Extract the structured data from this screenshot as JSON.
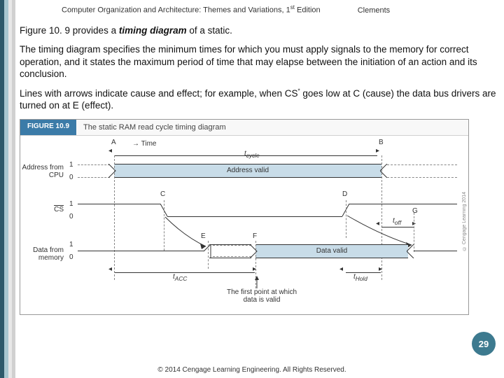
{
  "header": {
    "title_pre": "Computer Organization and Architecture: Themes and Variations, 1",
    "title_sup": "st",
    "title_post": " Edition",
    "author": "Clements"
  },
  "para1": {
    "lead": "Figure 10. 9 provides a ",
    "em": "timing diagram",
    "rest": " of a static."
  },
  "para2": "The timing diagram specifies the minimum times for which you must apply signals to the memory for correct operation, and it states the maximum period of time that may elapse between the initiation of an action and its conclusion.",
  "para3": {
    "pre": "Lines with arrows indicate cause and effect; for example, when CS",
    "sup": "*",
    "post": " goes low at C (cause) the data bus drivers are turned on at E (effect)."
  },
  "figure": {
    "badge": "FIGURE 10.9",
    "caption": "The static RAM read cycle timing diagram",
    "time_label": "Time",
    "tcycle": "t",
    "tcycle_sub": "cycle",
    "addr_label": "Address from CPU",
    "addr_valid": "Address valid",
    "cs_label_pre": "CS",
    "data_label": "Data from memory",
    "data_valid": "Data valid",
    "tacc": "t",
    "tacc_sub": "ACC",
    "thold": "t",
    "thold_sub": "Hold",
    "toff": "t",
    "toff_sub": "off",
    "first_point": "The first point at which data is valid",
    "A": "A",
    "B": "B",
    "C": "C",
    "D": "D",
    "E": "E",
    "F": "F",
    "G": "G",
    "lvl1": "1",
    "lvl0": "0",
    "vert_copy": "© Cengage Learning 2014"
  },
  "page_num": "29",
  "copyright": "© 2014 Cengage Learning Engineering. All Rights Reserved."
}
